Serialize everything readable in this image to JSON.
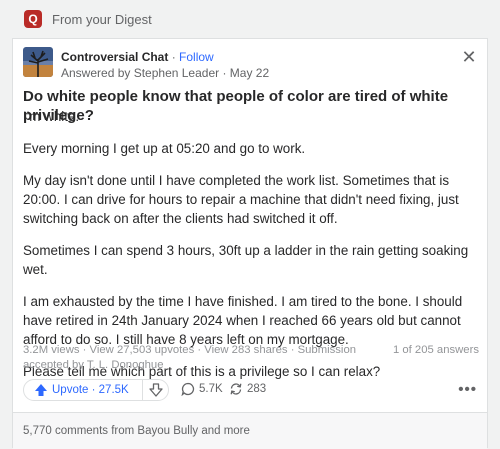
{
  "topbar": {
    "logo_letter": "Q",
    "digest_label": "From your Digest"
  },
  "post": {
    "space_name": "Controversial Chat",
    "separator": "·",
    "follow_label": "Follow",
    "answered_by": "Answered by Stephen Leader · May 22",
    "close_glyph": "✕",
    "question": "Do white people know that people of color are tired of white privilege?",
    "answer_paragraphs": [
      "I'm white.",
      "Every morning I get up at 05:20 and go to work.",
      "My day isn't done until I have completed the work list. Sometimes that is 20:00. I can drive for hours to repair a machine that didn't need fixing, just switching back on after the clients had switched it off.",
      "Sometimes I can spend 3 hours, 30ft up a ladder in the rain getting soaking wet.",
      "I am exhausted by the time I have finished. I am tired to the bone. I should have retired in 24th January 2024 when I reached 66 years old but cannot afford to do so. I still have 8 years left on my mortgage.",
      "Please tell me which part of this is a privilege so I can relax?"
    ],
    "stats_text": "3.2M views · View 27,503 upvotes · View 283 shares · Submission accepted by T. L. Donoghue",
    "answer_count": "1 of 205 answers",
    "upvote_label": "Upvote · 27.5K",
    "comment_count": "5.7K",
    "share_count": "283",
    "more_glyph": "•••",
    "comments_footer": "5,770 comments from Bayou Bully and more"
  },
  "colors": {
    "brand": "#b92b27",
    "accent": "#2e69ff",
    "muted": "#636466"
  },
  "icons": [
    "quora-logo-icon",
    "space-avatar",
    "close-icon",
    "upvote-arrow-icon",
    "downvote-arrow-icon",
    "comment-icon",
    "share-icon",
    "more-icon"
  ]
}
